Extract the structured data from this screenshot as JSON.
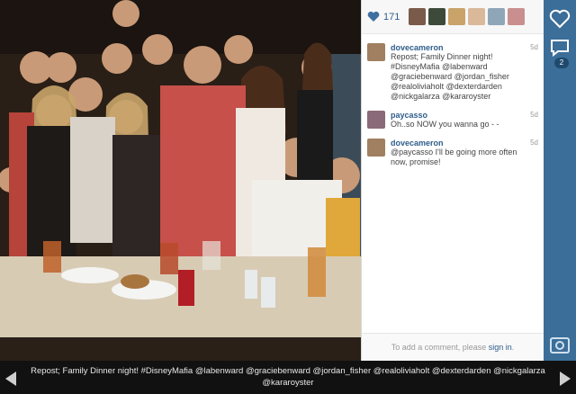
{
  "post": {
    "like_count": "171",
    "caption": "Repost; Family Dinner night! #DisneyMafia @labenward @graciebenward @jordan_fisher @realoliviaholt @dexterdarden @nickgalarza @kararoyster"
  },
  "comments": [
    {
      "user": "dovecameron",
      "time": "5d",
      "text": "Repost; Family Dinner night! #DisneyMafia @labenward @graciebenward @jordan_fisher @realoliviaholt @dexterdarden @nickgalarza @kararoyster"
    },
    {
      "user": "paycasso",
      "time": "5d",
      "text": "Oh..so NOW you wanna go -  -"
    },
    {
      "user": "dovecameron",
      "time": "5d",
      "text": "@paycasso I'll be going more often now, promise!"
    }
  ],
  "add_comment": {
    "prefix": "To add a comment, please ",
    "link": "sign in",
    "suffix": "."
  },
  "sidebar": {
    "comment_badge": "2"
  },
  "colors": {
    "link": "#2f5d8a",
    "sidebar": "#3b6e98",
    "heart": "#3f6fa0"
  },
  "icons": [
    "heart-icon",
    "like-icon",
    "comment-icon",
    "camera-icon",
    "prev-arrow-icon",
    "next-arrow-icon"
  ]
}
